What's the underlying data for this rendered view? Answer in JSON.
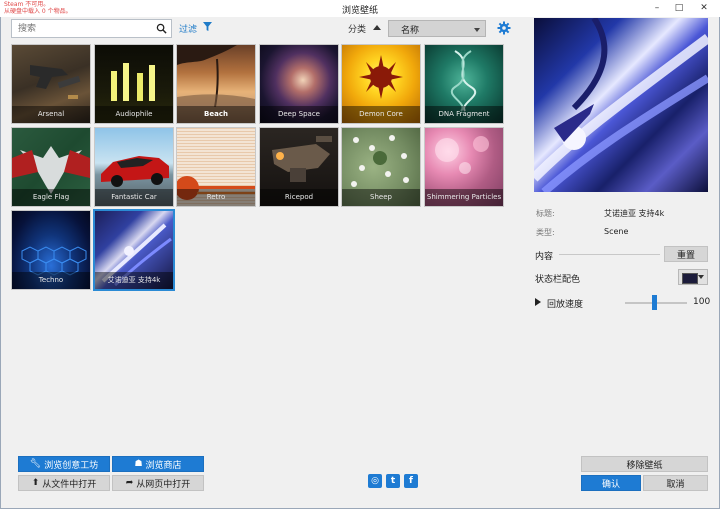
{
  "window": {
    "title": "浏览壁纸",
    "error_line1": "Steam 不可用。",
    "error_line2": "从硬盘中载入 0 个物品。"
  },
  "toolbar": {
    "search_placeholder": "搜索",
    "filter_label": "过滤",
    "category_label": "分类",
    "sort_value": "名称"
  },
  "wallpapers": [
    {
      "title": "Arsenal"
    },
    {
      "title": "Audiophile"
    },
    {
      "title": "Beach"
    },
    {
      "title": "Deep Space"
    },
    {
      "title": "Demon Core"
    },
    {
      "title": "DNA Fragment"
    },
    {
      "title": "Eagle Flag"
    },
    {
      "title": "Fantastic Car"
    },
    {
      "title": "Retro"
    },
    {
      "title": "Ricepod"
    },
    {
      "title": "Sheep"
    },
    {
      "title": "Shimmering Particles"
    },
    {
      "title": "Techno"
    },
    {
      "title": "艾诺迪亚 支持4k"
    }
  ],
  "details": {
    "title_key": "标题:",
    "title_value": "艾诺迪亚 支持4k",
    "type_key": "类型:",
    "type_value": "Scene",
    "content_label": "内容",
    "reset_button": "重置",
    "statusbar_color_label": "状态栏配色",
    "statusbar_color": "#1b1b3a",
    "speed_label": "回放速度",
    "speed_value": "100"
  },
  "bottom": {
    "workshop_button": "浏览创意工坊",
    "store_button": "浏览商店",
    "open_file_button": "从文件中打开",
    "open_web_button": "从网页中打开",
    "remove_button": "移除壁纸",
    "ok_button": "确认",
    "cancel_button": "取消"
  },
  "colors": {
    "accent": "#1e7bd3",
    "selected_border": "#2a8ad4"
  }
}
